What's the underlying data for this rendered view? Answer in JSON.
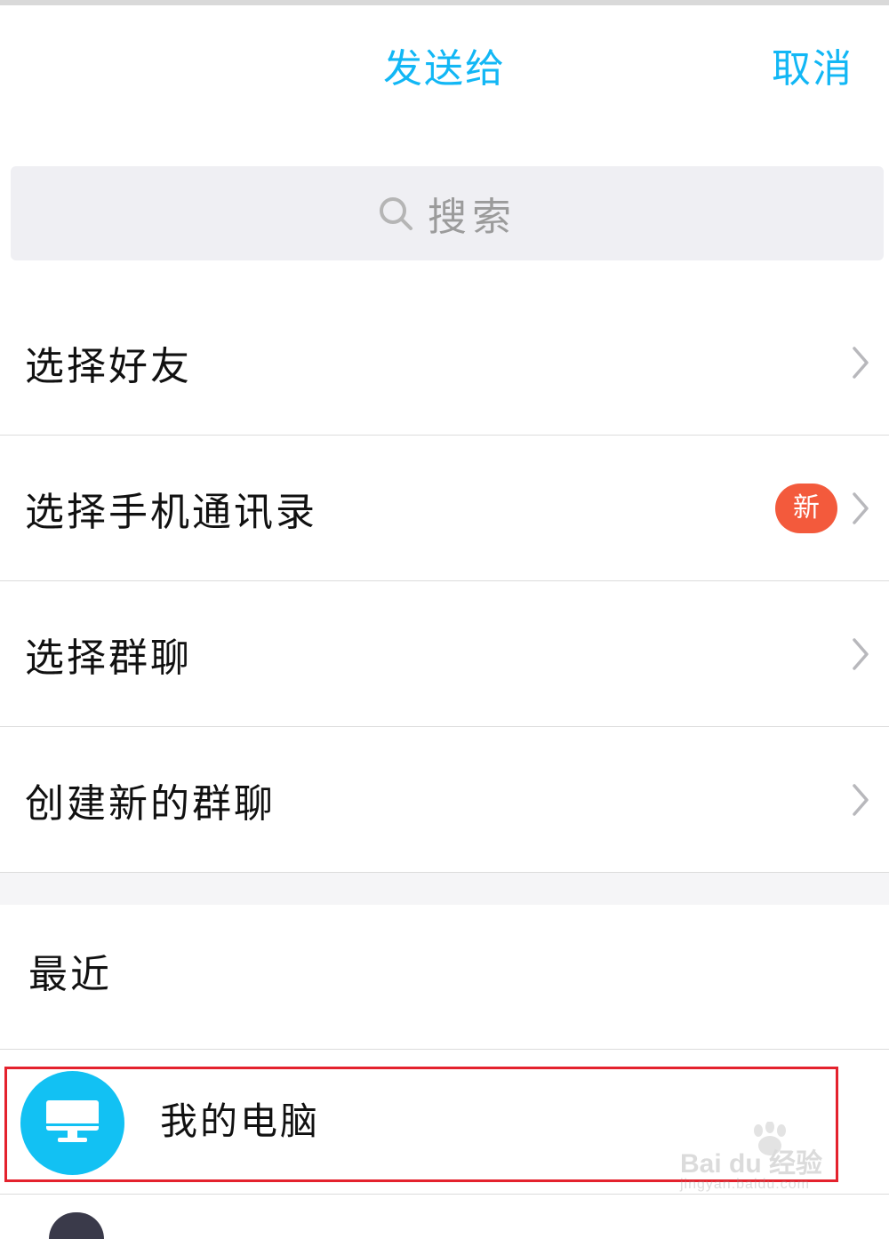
{
  "header": {
    "title": "发送给",
    "cancel_label": "取消",
    "accent_color": "#12b7f5"
  },
  "search": {
    "icon": "search-icon",
    "placeholder": "搜索"
  },
  "menu": {
    "items": [
      {
        "label": "选择好友",
        "icon": "chevron-right-icon"
      },
      {
        "label": "选择手机通讯录",
        "badge": "新",
        "badge_color": "#f35a3c",
        "icon": "chevron-right-icon"
      },
      {
        "label": "选择群聊",
        "icon": "chevron-right-icon"
      },
      {
        "label": "创建新的群聊",
        "icon": "chevron-right-icon"
      }
    ]
  },
  "recent": {
    "title": "最近",
    "items": [
      {
        "label": "我的电脑",
        "icon": "computer-icon",
        "avatar_color": "#12c1f3",
        "highlighted": true,
        "highlight_color": "#e4222d"
      }
    ]
  },
  "watermark": {
    "main": "Bai du 经验",
    "sub": "jingyan.baidu.com"
  }
}
